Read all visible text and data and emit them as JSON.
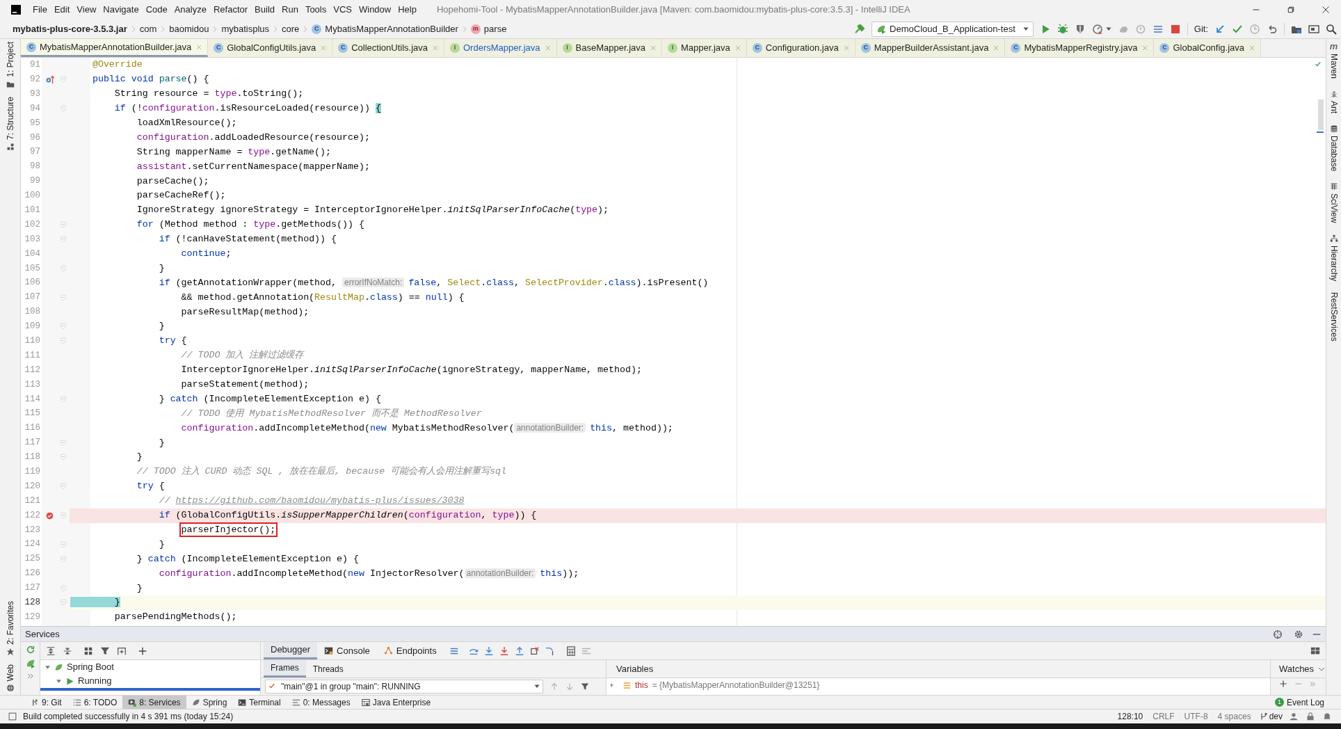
{
  "title_bar": {
    "menu": [
      "File",
      "Edit",
      "View",
      "Navigate",
      "Code",
      "Analyze",
      "Refactor",
      "Build",
      "Run",
      "Tools",
      "VCS",
      "Window",
      "Help"
    ],
    "title": "Hopehomi-Tool - MybatisMapperAnnotationBuilder.java [Maven: com.baomidou:mybatis-plus-core:3.5.3] - IntelliJ IDEA"
  },
  "navigation_bar": {
    "breadcrumbs": [
      {
        "label": "mybatis-plus-core-3.5.3.jar",
        "kind": "jar"
      },
      {
        "label": "com",
        "kind": "package"
      },
      {
        "label": "baomidou",
        "kind": "package"
      },
      {
        "label": "mybatisplus",
        "kind": "package"
      },
      {
        "label": "core",
        "kind": "package"
      },
      {
        "label": "MybatisMapperAnnotationBuilder",
        "kind": "class",
        "icon": "C"
      },
      {
        "label": "parse",
        "kind": "method",
        "icon": "m"
      }
    ],
    "run_configuration": "DemoCloud_B_Application-test",
    "vcs_label": "Git:"
  },
  "left_tool_strip": {
    "top": [
      {
        "label": "1: Project",
        "kind": "project"
      },
      {
        "label": "7: Structure",
        "kind": "structure"
      }
    ],
    "bottom": [
      {
        "label": "2: Favorites",
        "kind": "favorites"
      },
      {
        "label": "Web",
        "kind": "web"
      }
    ]
  },
  "right_tool_strip": [
    {
      "label": "Maven",
      "kind": "maven",
      "icon": "m"
    },
    {
      "label": "Ant",
      "kind": "ant"
    },
    {
      "label": "Database",
      "kind": "database"
    },
    {
      "label": "SciView",
      "kind": "sciview"
    },
    {
      "label": "Hierarchy",
      "kind": "hierarchy"
    },
    {
      "label": "RestServices",
      "kind": "rest"
    }
  ],
  "editor_tabs": [
    {
      "label": "MybatisMapperAnnotationBuilder.java",
      "icon": "C",
      "kind": "class",
      "selected": true,
      "modified": false
    },
    {
      "label": "GlobalConfigUtils.java",
      "icon": "C",
      "kind": "class",
      "selected": false,
      "modified": false
    },
    {
      "label": "CollectionUtils.java",
      "icon": "C",
      "kind": "class",
      "selected": false,
      "modified": false
    },
    {
      "label": "OrdersMapper.java",
      "icon": "I",
      "kind": "interface",
      "selected": false,
      "modified": true
    },
    {
      "label": "BaseMapper.java",
      "icon": "I",
      "kind": "interface",
      "selected": false,
      "modified": false
    },
    {
      "label": "Mapper.java",
      "icon": "I",
      "kind": "interface",
      "selected": false,
      "modified": false
    },
    {
      "label": "Configuration.java",
      "icon": "C",
      "kind": "class",
      "selected": false,
      "modified": false
    },
    {
      "label": "MapperBuilderAssistant.java",
      "icon": "C",
      "kind": "class",
      "selected": false,
      "modified": false
    },
    {
      "label": "MybatisMapperRegistry.java",
      "icon": "C",
      "kind": "class",
      "selected": false,
      "modified": false
    },
    {
      "label": "GlobalConfig.java",
      "icon": "C",
      "kind": "class",
      "selected": false,
      "modified": false
    }
  ],
  "editor": {
    "lines": [
      {
        "number": "91",
        "fold": false,
        "override": false,
        "breakpoint": false,
        "current": false,
        "tokens": [
          {
            "kind": "annotation",
            "text": "    @Override"
          }
        ]
      },
      {
        "number": "92",
        "fold": true,
        "override": true,
        "breakpoint": false,
        "current": false,
        "tokens": [
          {
            "kind": "keyword",
            "text": "    public void "
          },
          {
            "kind": "declaration",
            "text": "parse"
          },
          {
            "kind": "plain",
            "text": "() {"
          }
        ]
      },
      {
        "number": "93",
        "fold": false,
        "override": false,
        "breakpoint": false,
        "current": false,
        "tokens": [
          {
            "kind": "plain",
            "text": "        String resource = "
          },
          {
            "kind": "field",
            "text": "type"
          },
          {
            "kind": "plain",
            "text": ".toString();"
          }
        ]
      },
      {
        "number": "94",
        "fold": true,
        "override": false,
        "breakpoint": false,
        "current": false,
        "tokens": [
          {
            "kind": "keyword",
            "text": "        if"
          },
          {
            "kind": "plain",
            "text": " (!"
          },
          {
            "kind": "field",
            "text": "configuration"
          },
          {
            "kind": "plain",
            "text": ".isResourceLoaded(resource)) "
          },
          {
            "kind": "brace",
            "text": "{"
          }
        ]
      },
      {
        "number": "95",
        "fold": false,
        "override": false,
        "breakpoint": false,
        "current": false,
        "tokens": [
          {
            "kind": "plain",
            "text": "            loadXmlResource();"
          }
        ]
      },
      {
        "number": "96",
        "fold": false,
        "override": false,
        "breakpoint": false,
        "current": false,
        "tokens": [
          {
            "kind": "field",
            "text": "            configuration"
          },
          {
            "kind": "plain",
            "text": ".addLoadedResource(resource);"
          }
        ]
      },
      {
        "number": "97",
        "fold": false,
        "override": false,
        "breakpoint": false,
        "current": false,
        "tokens": [
          {
            "kind": "plain",
            "text": "            String mapperName = "
          },
          {
            "kind": "field",
            "text": "type"
          },
          {
            "kind": "plain",
            "text": ".getName();"
          }
        ]
      },
      {
        "number": "98",
        "fold": false,
        "override": false,
        "breakpoint": false,
        "current": false,
        "tokens": [
          {
            "kind": "field",
            "text": "            assistant"
          },
          {
            "kind": "plain",
            "text": ".setCurrentNamespace(mapperName);"
          }
        ]
      },
      {
        "number": "99",
        "fold": false,
        "override": false,
        "breakpoint": false,
        "current": false,
        "tokens": [
          {
            "kind": "plain",
            "text": "            parseCache();"
          }
        ]
      },
      {
        "number": "100",
        "fold": false,
        "override": false,
        "breakpoint": false,
        "current": false,
        "tokens": [
          {
            "kind": "plain",
            "text": "            parseCacheRef();"
          }
        ]
      },
      {
        "number": "101",
        "fold": false,
        "override": false,
        "breakpoint": false,
        "current": false,
        "tokens": [
          {
            "kind": "plain",
            "text": "            IgnoreStrategy ignoreStrategy = InterceptorIgnoreHelper."
          },
          {
            "kind": "static",
            "text": "initSqlParserInfoCache"
          },
          {
            "kind": "plain",
            "text": "("
          },
          {
            "kind": "field",
            "text": "type"
          },
          {
            "kind": "plain",
            "text": ");"
          }
        ]
      },
      {
        "number": "102",
        "fold": true,
        "override": false,
        "breakpoint": false,
        "current": false,
        "tokens": [
          {
            "kind": "keyword",
            "text": "            for"
          },
          {
            "kind": "plain",
            "text": " (Method method : "
          },
          {
            "kind": "field",
            "text": "type"
          },
          {
            "kind": "plain",
            "text": ".getMethods()) {"
          }
        ]
      },
      {
        "number": "103",
        "fold": true,
        "override": false,
        "breakpoint": false,
        "current": false,
        "tokens": [
          {
            "kind": "keyword",
            "text": "                if"
          },
          {
            "kind": "plain",
            "text": " (!canHaveStatement(method)) {"
          }
        ]
      },
      {
        "number": "104",
        "fold": false,
        "override": false,
        "breakpoint": false,
        "current": false,
        "tokens": [
          {
            "kind": "keyword",
            "text": "                    continue"
          },
          {
            "kind": "plain",
            "text": ";"
          }
        ]
      },
      {
        "number": "105",
        "fold": true,
        "override": false,
        "breakpoint": false,
        "current": false,
        "tokens": [
          {
            "kind": "plain",
            "text": "                }"
          }
        ]
      },
      {
        "number": "106",
        "fold": false,
        "override": false,
        "breakpoint": false,
        "current": false,
        "tokens": [
          {
            "kind": "keyword",
            "text": "                if"
          },
          {
            "kind": "plain",
            "text": " (getAnnotationWrapper(method, "
          },
          {
            "kind": "hint",
            "text": "errorIfNoMatch:"
          },
          {
            "kind": "keyword",
            "text": "false"
          },
          {
            "kind": "plain",
            "text": ", "
          },
          {
            "kind": "typeref",
            "text": "Select"
          },
          {
            "kind": "plain",
            "text": "."
          },
          {
            "kind": "keyword",
            "text": "class"
          },
          {
            "kind": "plain",
            "text": ", "
          },
          {
            "kind": "typeref",
            "text": "SelectProvider"
          },
          {
            "kind": "plain",
            "text": "."
          },
          {
            "kind": "keyword",
            "text": "class"
          },
          {
            "kind": "plain",
            "text": ").isPresent()"
          }
        ]
      },
      {
        "number": "107",
        "fold": true,
        "override": false,
        "breakpoint": false,
        "current": false,
        "tokens": [
          {
            "kind": "plain",
            "text": "                    && method.getAnnotation("
          },
          {
            "kind": "typeref",
            "text": "ResultMap"
          },
          {
            "kind": "plain",
            "text": "."
          },
          {
            "kind": "keyword",
            "text": "class"
          },
          {
            "kind": "plain",
            "text": ") == "
          },
          {
            "kind": "keyword",
            "text": "null"
          },
          {
            "kind": "plain",
            "text": ") {"
          }
        ]
      },
      {
        "number": "108",
        "fold": false,
        "override": false,
        "breakpoint": false,
        "current": false,
        "tokens": [
          {
            "kind": "plain",
            "text": "                    parseResultMap(method);"
          }
        ]
      },
      {
        "number": "109",
        "fold": true,
        "override": false,
        "breakpoint": false,
        "current": false,
        "tokens": [
          {
            "kind": "plain",
            "text": "                }"
          }
        ]
      },
      {
        "number": "110",
        "fold": true,
        "override": false,
        "breakpoint": false,
        "current": false,
        "tokens": [
          {
            "kind": "keyword",
            "text": "                try"
          },
          {
            "kind": "plain",
            "text": " {"
          }
        ]
      },
      {
        "number": "111",
        "fold": false,
        "override": false,
        "breakpoint": false,
        "current": false,
        "tokens": [
          {
            "kind": "comment",
            "text": "                    // TODO 加入 注解过滤缓存"
          }
        ]
      },
      {
        "number": "112",
        "fold": false,
        "override": false,
        "breakpoint": false,
        "current": false,
        "tokens": [
          {
            "kind": "plain",
            "text": "                    InterceptorIgnoreHelper."
          },
          {
            "kind": "static",
            "text": "initSqlParserInfoCache"
          },
          {
            "kind": "plain",
            "text": "(ignoreStrategy, mapperName, method);"
          }
        ]
      },
      {
        "number": "113",
        "fold": false,
        "override": false,
        "breakpoint": false,
        "current": false,
        "tokens": [
          {
            "kind": "plain",
            "text": "                    parseStatement(method);"
          }
        ]
      },
      {
        "number": "114",
        "fold": true,
        "override": false,
        "breakpoint": false,
        "current": false,
        "tokens": [
          {
            "kind": "plain",
            "text": "                } "
          },
          {
            "kind": "keyword",
            "text": "catch"
          },
          {
            "kind": "plain",
            "text": " (IncompleteElementException e) {"
          }
        ]
      },
      {
        "number": "115",
        "fold": false,
        "override": false,
        "breakpoint": false,
        "current": false,
        "tokens": [
          {
            "kind": "comment",
            "text": "                    // TODO 使用 MybatisMethodResolver 而不是 MethodResolver"
          }
        ]
      },
      {
        "number": "116",
        "fold": false,
        "override": false,
        "breakpoint": false,
        "current": false,
        "tokens": [
          {
            "kind": "field",
            "text": "                    configuration"
          },
          {
            "kind": "plain",
            "text": ".addIncompleteMethod("
          },
          {
            "kind": "keyword",
            "text": "new"
          },
          {
            "kind": "plain",
            "text": " MybatisMethodResolver("
          },
          {
            "kind": "hint",
            "text": "annotationBuilder:"
          },
          {
            "kind": "keyword",
            "text": "this"
          },
          {
            "kind": "plain",
            "text": ", method));"
          }
        ]
      },
      {
        "number": "117",
        "fold": true,
        "override": false,
        "breakpoint": false,
        "current": false,
        "tokens": [
          {
            "kind": "plain",
            "text": "                }"
          }
        ]
      },
      {
        "number": "118",
        "fold": true,
        "override": false,
        "breakpoint": false,
        "current": false,
        "tokens": [
          {
            "kind": "plain",
            "text": "            }"
          }
        ]
      },
      {
        "number": "119",
        "fold": false,
        "override": false,
        "breakpoint": false,
        "current": false,
        "tokens": [
          {
            "kind": "comment",
            "text": "            // TODO 注入 CURD 动态 SQL , 放在在最后, because 可能会有人会用注解重写sql"
          }
        ]
      },
      {
        "number": "120",
        "fold": true,
        "override": false,
        "breakpoint": false,
        "current": false,
        "tokens": [
          {
            "kind": "keyword",
            "text": "            try"
          },
          {
            "kind": "plain",
            "text": " {"
          }
        ]
      },
      {
        "number": "121",
        "fold": false,
        "override": false,
        "breakpoint": false,
        "current": false,
        "tokens": [
          {
            "kind": "comment",
            "text": "                // "
          },
          {
            "kind": "link",
            "text": "https://github.com/baomidou/mybatis-plus/issues/3038"
          }
        ]
      },
      {
        "number": "122",
        "fold": true,
        "override": false,
        "breakpoint": true,
        "current": false,
        "tokens": [
          {
            "kind": "keyword",
            "text": "                if"
          },
          {
            "kind": "plain",
            "text": " (GlobalConfigUtils."
          },
          {
            "kind": "static",
            "text": "isSupperMapperChildren"
          },
          {
            "kind": "plain",
            "text": "("
          },
          {
            "kind": "field",
            "text": "configuration"
          },
          {
            "kind": "plain",
            "text": ", "
          },
          {
            "kind": "field",
            "text": "type"
          },
          {
            "kind": "plain",
            "text": ")) {"
          }
        ]
      },
      {
        "number": "123",
        "fold": false,
        "override": false,
        "breakpoint": false,
        "current": false,
        "tokens": [
          {
            "kind": "boxed",
            "text": "                    parserInjector();"
          }
        ]
      },
      {
        "number": "124",
        "fold": true,
        "override": false,
        "breakpoint": false,
        "current": false,
        "tokens": [
          {
            "kind": "plain",
            "text": "                }"
          }
        ]
      },
      {
        "number": "125",
        "fold": true,
        "override": false,
        "breakpoint": false,
        "current": false,
        "tokens": [
          {
            "kind": "plain",
            "text": "            } "
          },
          {
            "kind": "keyword",
            "text": "catch"
          },
          {
            "kind": "plain",
            "text": " (IncompleteElementException e) {"
          }
        ]
      },
      {
        "number": "126",
        "fold": false,
        "override": false,
        "breakpoint": false,
        "current": false,
        "tokens": [
          {
            "kind": "field",
            "text": "                configuration"
          },
          {
            "kind": "plain",
            "text": ".addIncompleteMethod("
          },
          {
            "kind": "keyword",
            "text": "new"
          },
          {
            "kind": "plain",
            "text": " InjectorResolver("
          },
          {
            "kind": "hint",
            "text": "annotationBuilder:"
          },
          {
            "kind": "keyword",
            "text": "this"
          },
          {
            "kind": "plain",
            "text": "));"
          }
        ]
      },
      {
        "number": "127",
        "fold": true,
        "override": false,
        "breakpoint": false,
        "current": false,
        "tokens": [
          {
            "kind": "plain",
            "text": "            }"
          }
        ]
      },
      {
        "number": "128",
        "fold": true,
        "override": false,
        "breakpoint": false,
        "current": true,
        "tokens": [
          {
            "kind": "brace",
            "text": "        }"
          }
        ]
      },
      {
        "number": "129",
        "fold": false,
        "override": false,
        "breakpoint": false,
        "current": false,
        "tokens": [
          {
            "kind": "plain",
            "text": "        parsePendingMethods();"
          }
        ]
      }
    ]
  },
  "services": {
    "title": "Services",
    "tree": [
      {
        "label": "Spring Boot",
        "kind": "spring",
        "expanded": true,
        "children": [
          {
            "label": "Running",
            "kind": "running",
            "expanded": true
          }
        ]
      }
    ],
    "debugger_tabs": [
      {
        "label": "Debugger",
        "kind": "debugger",
        "selected": true
      },
      {
        "label": "Console",
        "kind": "console",
        "selected": false
      },
      {
        "label": "Endpoints",
        "kind": "endpoints",
        "selected": false
      }
    ],
    "frame_tabs": [
      {
        "label": "Frames",
        "selected": true
      },
      {
        "label": "Threads",
        "selected": false
      }
    ],
    "thread_selector": "\"main\"@1 in group \"main\": RUNNING",
    "variables_title": "Variables",
    "variables": [
      {
        "name": "this",
        "value": "= {MybatisMapperAnnotationBuilder@13251}"
      }
    ],
    "watches_title": "Watches"
  },
  "tool_window_bar": [
    {
      "label": "9: Git",
      "kind": "git",
      "selected": false
    },
    {
      "label": "6: TODO",
      "kind": "todo",
      "selected": false
    },
    {
      "label": "8: Services",
      "kind": "services",
      "selected": true
    },
    {
      "label": "Spring",
      "kind": "spring",
      "selected": false
    },
    {
      "label": "Terminal",
      "kind": "terminal",
      "selected": false
    },
    {
      "label": "0: Messages",
      "kind": "messages",
      "selected": false
    },
    {
      "label": "Java Enterprise",
      "kind": "javaee",
      "selected": false
    }
  ],
  "event_log": {
    "label": "Event Log",
    "count": "1"
  },
  "status_bar": {
    "message": "Build completed successfully in 4 s 391 ms (today 15:24)",
    "position": "128:10",
    "items": [
      "CRLF",
      "UTF-8",
      "4 spaces"
    ],
    "branch": "dev"
  }
}
